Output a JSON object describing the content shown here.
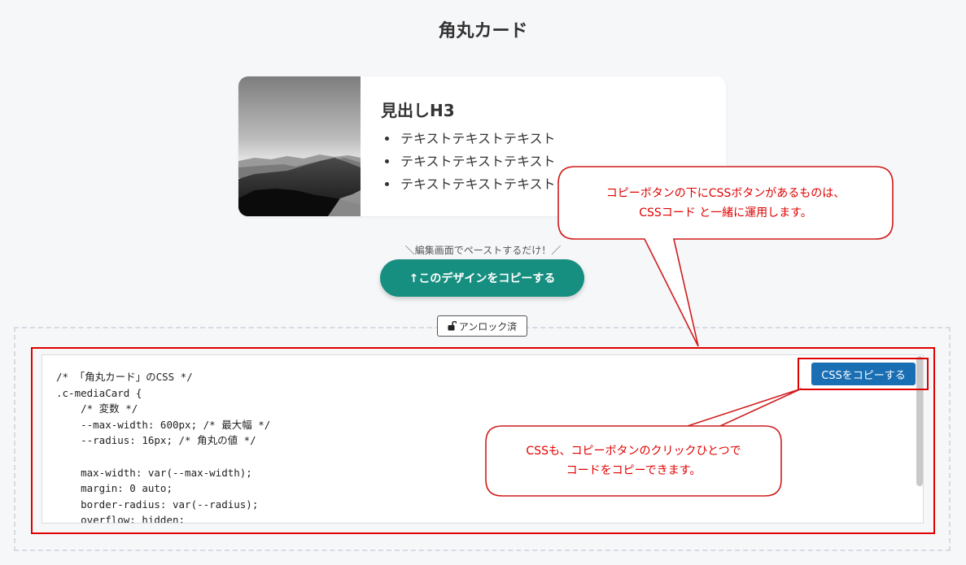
{
  "page": {
    "title": "角丸カード"
  },
  "card": {
    "heading": "見出しH3",
    "items": [
      "テキストテキストテキスト",
      "テキストテキストテキスト",
      "テキストテキストテキスト"
    ]
  },
  "copy_hint": "＼編集画面でペーストするだけ！／",
  "copy_design_button": "↑このデザインをコピーする",
  "unlock_badge": {
    "icon": "unlock-icon",
    "label": "アンロック済"
  },
  "css_copy_button": "CSSをコピーする",
  "code_lines": [
    "/* 「角丸カード」のCSS */",
    ".c-mediaCard {",
    "    /* 変数 */",
    "    --max-width: 600px; /* 最大幅 */",
    "    --radius: 16px; /* 角丸の値 */",
    "",
    "    max-width: var(--max-width);",
    "    margin: 0 auto;",
    "    border-radius: var(--radius);",
    "    overflow: hidden;"
  ],
  "callouts": {
    "top": {
      "line1": "コピーボタンの下にCSSボタンがあるものは、",
      "line2": "CSSコード と一緒に運用します。"
    },
    "bottom": {
      "line1": "CSSも、コピーボタンのクリックひとつで",
      "line2": "コードをコピーできます。"
    }
  },
  "colors": {
    "accent_teal": "#178f80",
    "css_button_blue": "#1a6fb4",
    "annotation_red": "#e00000"
  }
}
